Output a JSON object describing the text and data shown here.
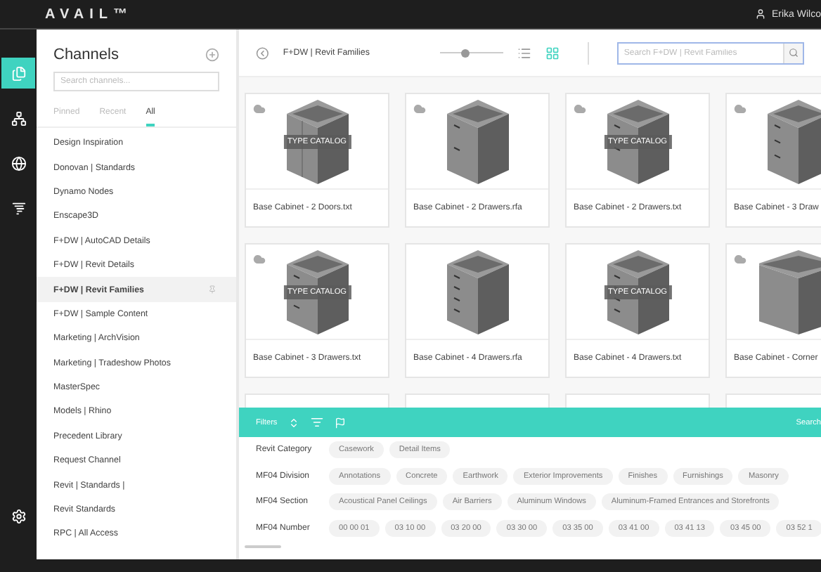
{
  "topbar": {
    "logo": "AVAIL™",
    "user": "Erika Wilco"
  },
  "rail": [
    {
      "kind": "channels",
      "selected": true
    },
    {
      "kind": "network",
      "selected": false
    },
    {
      "kind": "globe",
      "selected": false
    },
    {
      "kind": "swirl",
      "selected": false
    },
    {
      "kind": "settings",
      "selected": false
    }
  ],
  "sidebar": {
    "title": "Channels",
    "search": {
      "placeholder": "Search channels..."
    },
    "tabs": [
      {
        "label": "Pinned",
        "selected": false
      },
      {
        "label": "Recent",
        "selected": false
      },
      {
        "label": "All",
        "selected": true
      }
    ],
    "items": [
      {
        "label": "Design Inspiration",
        "selected": false
      },
      {
        "label": "Donovan | Standards",
        "selected": false
      },
      {
        "label": "Dynamo Nodes",
        "selected": false
      },
      {
        "label": "Enscape3D",
        "selected": false
      },
      {
        "label": "F+DW | AutoCAD Details",
        "selected": false
      },
      {
        "label": "F+DW | Revit Details",
        "selected": false
      },
      {
        "label": "F+DW | Revit Families",
        "selected": true
      },
      {
        "label": "F+DW | Sample Content",
        "selected": false
      },
      {
        "label": "Marketing | ArchVision",
        "selected": false
      },
      {
        "label": "Marketing | Tradeshow Photos",
        "selected": false
      },
      {
        "label": "MasterSpec",
        "selected": false
      },
      {
        "label": "Models | Rhino",
        "selected": false
      },
      {
        "label": "Precedent Library",
        "selected": false
      },
      {
        "label": "Request Channel",
        "selected": false
      },
      {
        "label": "Revit | Standards |",
        "selected": false
      },
      {
        "label": "Revit Standards",
        "selected": false
      },
      {
        "label": "RPC | All Access",
        "selected": false
      }
    ]
  },
  "toolbar": {
    "breadcrumb": "F+DW | Revit Families",
    "zoom": {
      "level": 0.4
    },
    "views": [
      {
        "kind": "list",
        "selected": false
      },
      {
        "kind": "grid",
        "selected": true
      }
    ],
    "search": {
      "placeholder": "Search F+DW | Revit Families"
    }
  },
  "cards": [
    {
      "title": "Base Cabinet - 2 Doors.txt",
      "kind": "doors",
      "cloud": true,
      "badge": "TYPE CATALOG"
    },
    {
      "title": "Base Cabinet - 2 Drawers.rfa",
      "kind": "twodrawer",
      "cloud": true
    },
    {
      "title": "Base Cabinet - 2 Drawers.txt",
      "kind": "twodrawer",
      "cloud": true,
      "badge": "TYPE CATALOG"
    },
    {
      "title": "Base Cabinet - 3 Draw",
      "kind": "threedrawer",
      "cloud": true
    },
    {
      "title": "Base Cabinet - 3 Drawers.txt",
      "kind": "threedrawer",
      "cloud": true,
      "badge": "TYPE CATALOG"
    },
    {
      "title": "Base Cabinet - 4 Drawers.rfa",
      "kind": "fourdrawer",
      "cloud": false
    },
    {
      "title": "Base Cabinet - 4 Drawers.txt",
      "kind": "fourdrawer",
      "cloud": false,
      "badge": "TYPE CATALOG"
    },
    {
      "title": "Base Cabinet - Corner",
      "kind": "corner",
      "cloud": true
    },
    {
      "kind": "top"
    },
    {
      "kind": "top"
    },
    {
      "kind": "top"
    },
    {
      "kind": "top"
    }
  ],
  "filters": {
    "title": "Filters",
    "search": "Search",
    "rows": [
      {
        "label": "Revit Category",
        "chips": [
          "Casework",
          "Detail Items"
        ]
      },
      {
        "label": "MF04 Division",
        "chips": [
          "Annotations",
          "Concrete",
          "Earthwork",
          "Exterior Improvements",
          "Finishes",
          "Furnishings",
          "Masonry"
        ]
      },
      {
        "label": "MF04 Section",
        "chips": [
          "Acoustical Panel Ceilings",
          "Air Barriers",
          "Aluminum Windows",
          "Aluminum-Framed Entrances and Storefronts"
        ]
      },
      {
        "label": "MF04 Number",
        "chips": [
          "00 00 01",
          "03 10 00",
          "03 20 00",
          "03 30 00",
          "03 35 00",
          "03 41 00",
          "03 41 13",
          "03 45 00",
          "03 52 1"
        ]
      }
    ]
  }
}
